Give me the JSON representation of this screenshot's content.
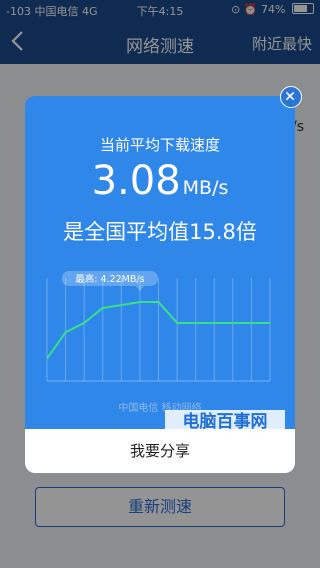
{
  "status_bar": {
    "signal": "-103",
    "carrier": "中国电信",
    "network": "4G",
    "time": "下午4:15",
    "battery": "74%",
    "battery_level": 0.74
  },
  "nav": {
    "back_icon": "chevron-left-icon",
    "title": "网络测速",
    "right_link": "附近最快"
  },
  "background": {
    "unit_fragment": "/s",
    "retest_button": "重新测速"
  },
  "modal": {
    "avg_label": "当前平均下载速度",
    "speed_value": "3.08",
    "speed_unit": "MB/s",
    "comparison": "是全国平均值15.8倍",
    "peak_label": "最高: 4.22MB/s",
    "carriers": "中国电信  移动网络",
    "share_button": "我要分享",
    "close_icon": "close-icon"
  },
  "watermark": "电脑百事网",
  "colors": {
    "header": "#1d4a8c",
    "modal": "#2f87ea",
    "line": "#37e08a",
    "accent": "#2a6fd6"
  },
  "chart_data": {
    "type": "line",
    "xlabel": "",
    "ylabel": "",
    "title": "",
    "peak_label": "最高: 4.22MB/s",
    "y_unit": "MB/s",
    "ylim": [
      0,
      5.5
    ],
    "grid": true,
    "x": [
      0,
      1,
      2,
      3,
      4,
      5,
      6,
      7,
      8,
      9,
      10,
      11,
      12
    ],
    "values": [
      1.2,
      2.6,
      3.1,
      3.9,
      4.05,
      4.22,
      4.22,
      3.1,
      3.1,
      3.1,
      3.1,
      3.1,
      3.1
    ]
  }
}
